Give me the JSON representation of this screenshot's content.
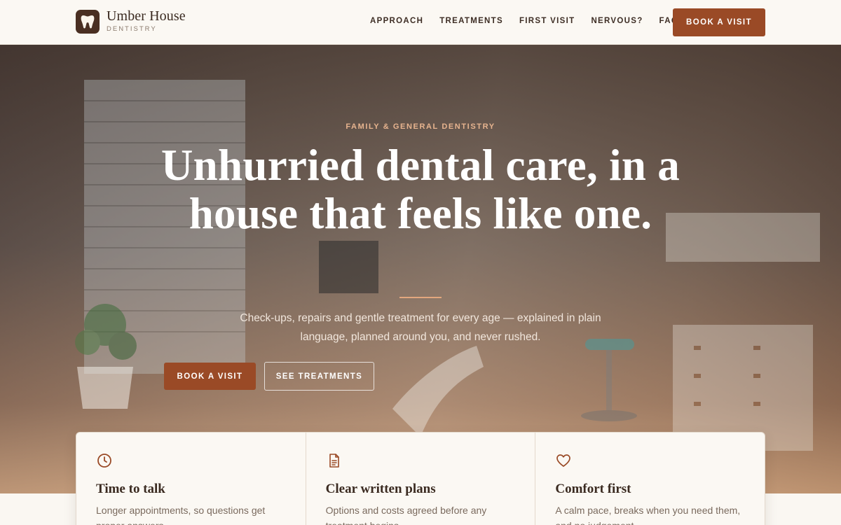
{
  "brand": {
    "name": "Umber House",
    "tagline": "DENTISTRY",
    "logo_icon": "tooth-icon"
  },
  "nav": {
    "items": [
      "APPROACH",
      "TREATMENTS",
      "FIRST VISIT",
      "NERVOUS?",
      "FAQ"
    ],
    "cta": "BOOK A VISIT"
  },
  "hero": {
    "eyebrow": "FAMILY & GENERAL DENTISTRY",
    "title": "Unhurried dental care, in a house that feels like one.",
    "subtitle": "Check-ups, repairs and gentle treatment for every age — explained in plain language, planned around you, and never rushed.",
    "primary_cta": "BOOK A VISIT",
    "secondary_cta": "SEE TREATMENTS"
  },
  "features": [
    {
      "icon": "clock-icon",
      "title": "Time to talk",
      "text": "Longer appointments, so questions get proper answers."
    },
    {
      "icon": "document-icon",
      "title": "Clear written plans",
      "text": "Options and costs agreed before any treatment begins."
    },
    {
      "icon": "heart-icon",
      "title": "Comfort first",
      "text": "A calm pace, breaks when you need them, and no judgement."
    }
  ],
  "colors": {
    "accent": "#9a4a26",
    "dark_brown": "#4a2f22",
    "eyebrow": "#e7b48f",
    "background": "#faf7f2"
  }
}
